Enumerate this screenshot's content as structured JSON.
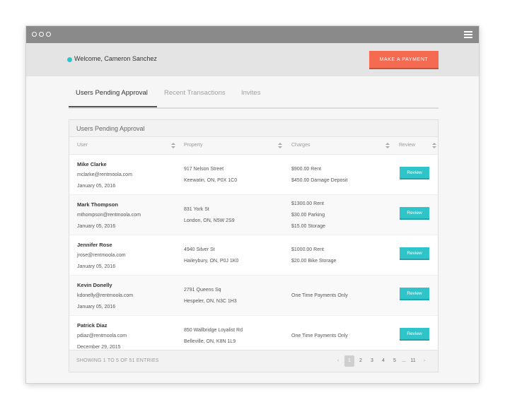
{
  "header": {
    "welcome": "Welcome, Cameron Sanchez",
    "payment_button": "MAKE A PAYMENT"
  },
  "tabs": [
    {
      "label": "Users Pending Approval"
    },
    {
      "label": "Recent Transactions"
    },
    {
      "label": "Invites"
    }
  ],
  "panel": {
    "title": "Users Pending Approval",
    "columns": [
      "User",
      "Property",
      "Charges",
      "Review"
    ]
  },
  "rows": [
    {
      "name": "Mike Clarke",
      "email": "mclarke@rentmoola.com",
      "date": "January 05, 2016",
      "address1": "917 Nelson Street",
      "address2": "Keewatin, ON, P0X 1C0",
      "charges": [
        "$900.00 Rent",
        "$450.00 Damage Deposit"
      ],
      "review": "Review"
    },
    {
      "name": "Mark Thompson",
      "email": "mthompson@rentmoola.com",
      "date": "January 05, 2016",
      "address1": "831 York St",
      "address2": "London, ON, N5W 2S9",
      "charges": [
        "$1300.00 Rent",
        "$30.00 Parking",
        "$15.00 Storage"
      ],
      "review": "Review"
    },
    {
      "name": "Jennifer Rose",
      "email": "jrose@rentmoola.com",
      "date": "January 05, 2016",
      "address1": "4940 Silver St",
      "address2": "Haileybury, ON, P0J 1K0",
      "charges": [
        "$1000.00 Rent",
        "$20.00 Bike Storage"
      ],
      "review": "Review"
    },
    {
      "name": "Kevin Donelly",
      "email": "kdonelly@rentmoola.com",
      "date": "January 05, 2016",
      "address1": "2791 Queens Sq",
      "address2": "Hespeler, ON, N3C 1H3",
      "charges": [
        "One Time Payments Only"
      ],
      "review": "Review"
    },
    {
      "name": "Patrick Diaz",
      "email": "pdiaz@rentmoola.com",
      "date": "December 29, 2015",
      "address1": "850 Wallbridge Loyalist Rd",
      "address2": "Belleville, ON, K8N 1L9",
      "charges": [
        "One Time Payments Only"
      ],
      "review": "Review"
    }
  ],
  "footer": {
    "entries": "SHOWING 1 TO 5 OF 51 ENTRIES",
    "pages": [
      "1",
      "2",
      "3",
      "4",
      "5",
      "...",
      "11"
    ],
    "prev": "‹",
    "next": "›"
  },
  "colors": {
    "accent": "#2ec4c9",
    "primary_button": "#f56b52"
  }
}
